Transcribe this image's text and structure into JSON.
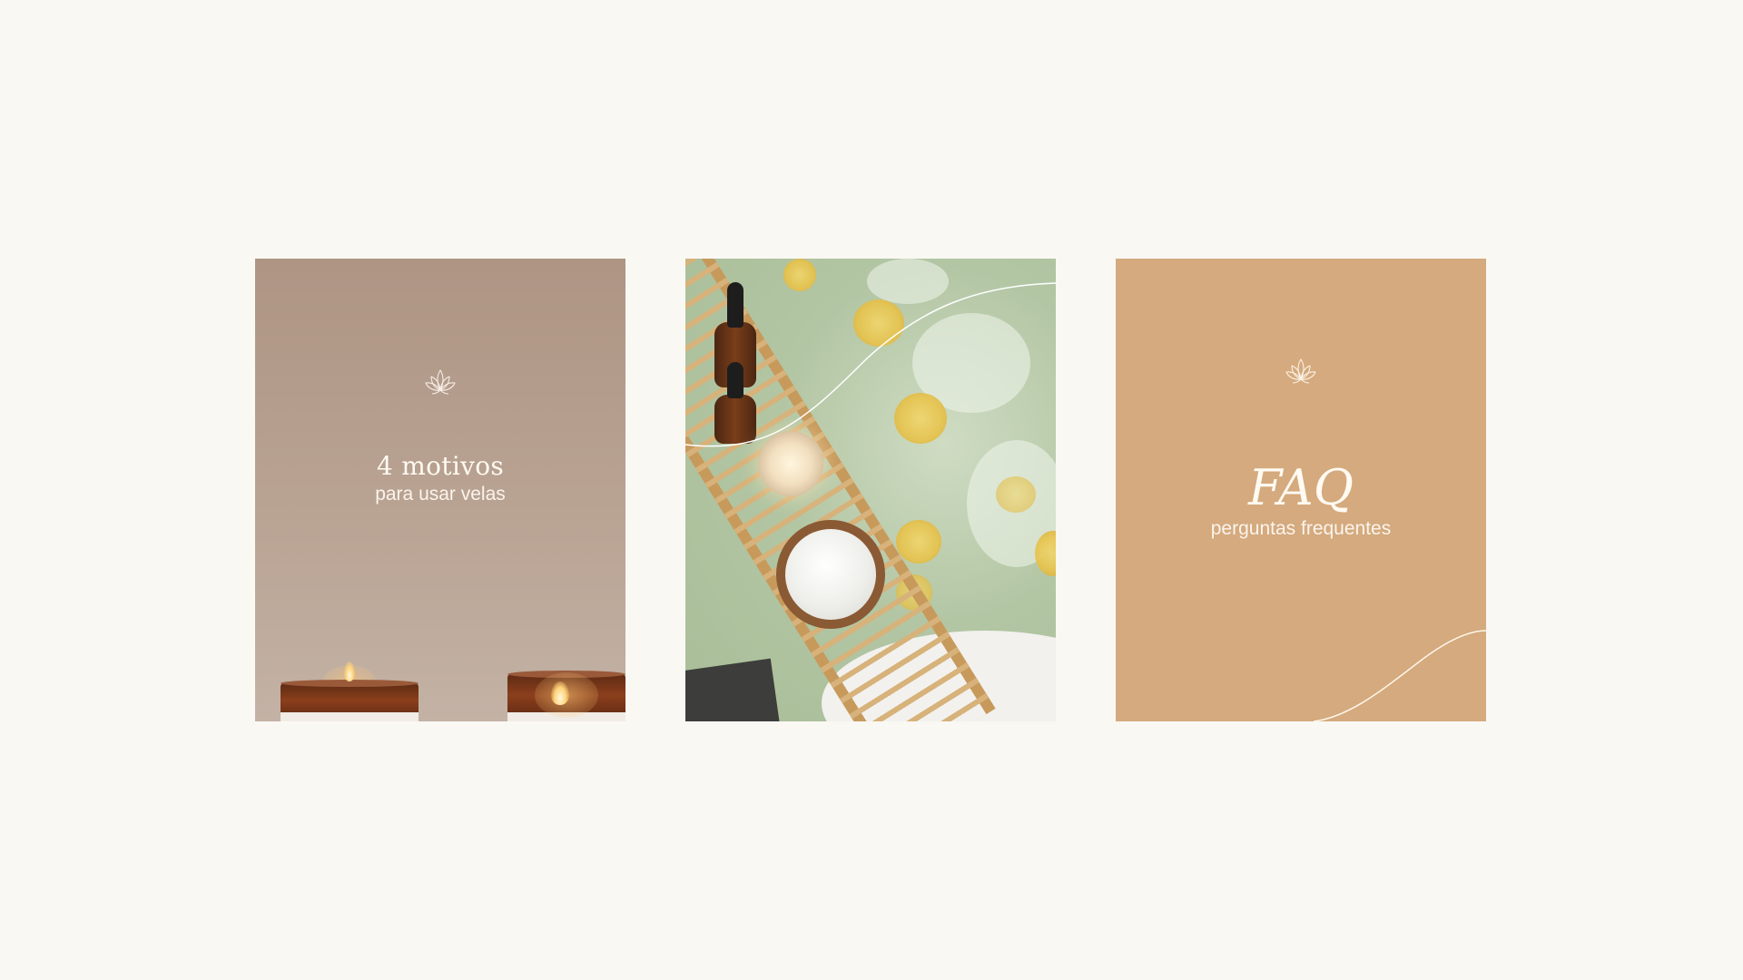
{
  "cards": {
    "reasons": {
      "title": "4 motivos",
      "subtitle": "para usar velas",
      "icon": "lotus-icon"
    },
    "spa": {
      "icon": "none"
    },
    "faq": {
      "title": "FAQ",
      "subtitle": "perguntas frequentes",
      "icon": "lotus-icon"
    }
  },
  "colors": {
    "background": "#faf8f3",
    "card_reasons": "#b8a090",
    "card_faq": "#d4aa7e",
    "text": "#fffaf2"
  }
}
